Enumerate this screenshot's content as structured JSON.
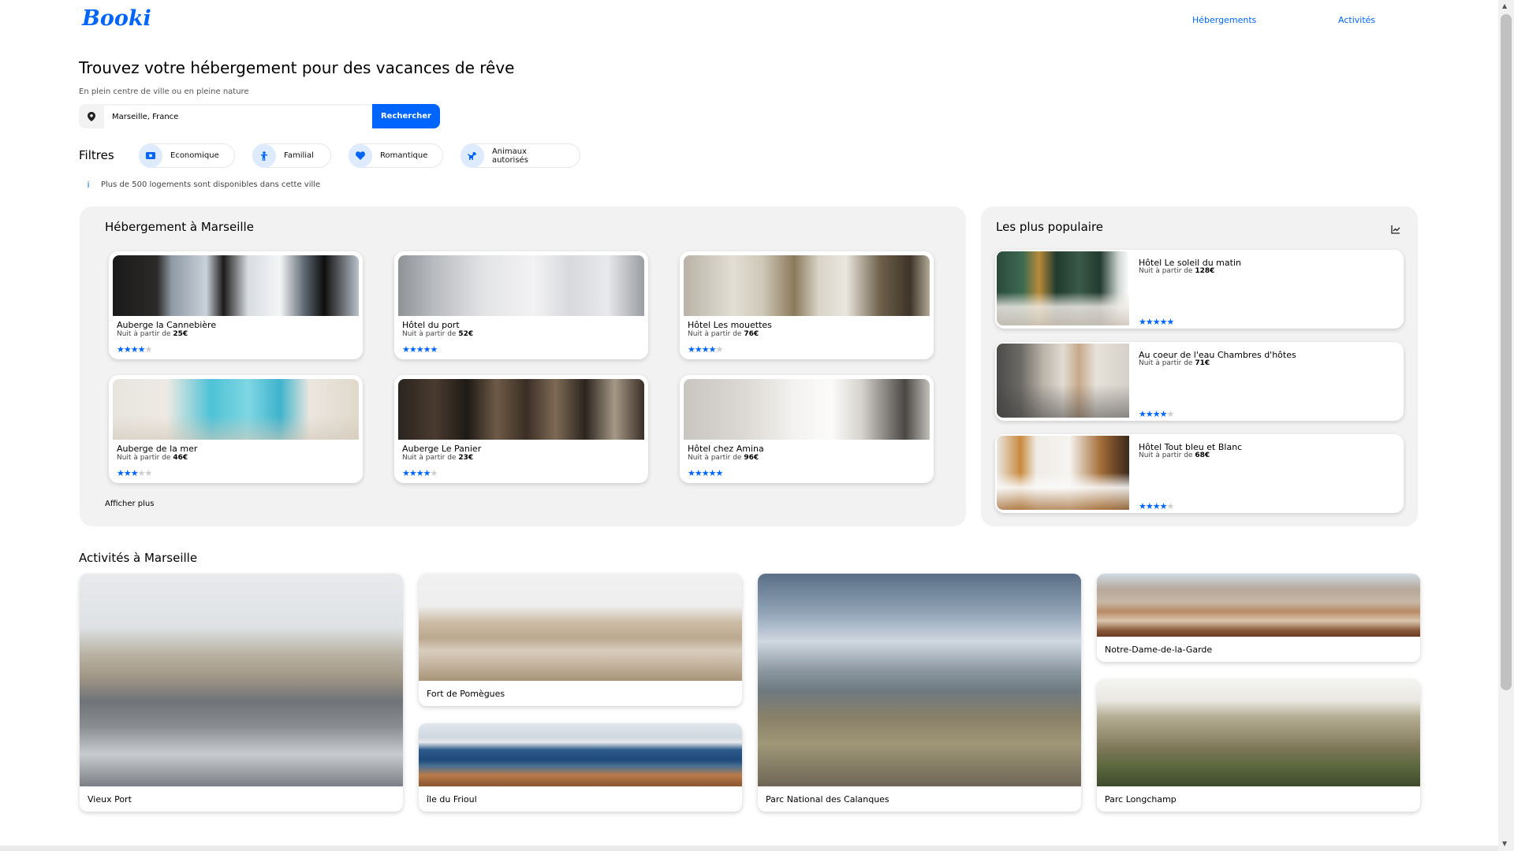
{
  "brand": "Booki",
  "nav": {
    "items": [
      "Hébergements",
      "Activités"
    ]
  },
  "hero": {
    "title": "Trouvez votre hébergement pour des vacances de rêve",
    "subtitle": "En plein centre de ville ou en pleine nature",
    "search_value": "Marseille, France",
    "search_button": "Rechercher"
  },
  "filters": {
    "label": "Filtres",
    "items": [
      {
        "label": "Economique",
        "icon": "money-icon"
      },
      {
        "label": "Familial",
        "icon": "child-icon"
      },
      {
        "label": "Romantique",
        "icon": "heart-icon"
      },
      {
        "label": "Animaux autorisés",
        "icon": "dog-icon"
      }
    ]
  },
  "info": "Plus de 500 logements sont disponibles dans cette ville",
  "accommodations": {
    "title": "Hébergement à Marseille",
    "price_prefix": "Nuit à partir de",
    "show_more": "Afficher plus",
    "items": [
      {
        "name": "Auberge la Cannebière",
        "price": "25€",
        "rating": 4
      },
      {
        "name": "Hôtel du port",
        "price": "52€",
        "rating": 5
      },
      {
        "name": "Hôtel Les mouettes",
        "price": "76€",
        "rating": 4
      },
      {
        "name": "Auberge de la mer",
        "price": "46€",
        "rating": 3
      },
      {
        "name": "Auberge Le Panier",
        "price": "23€",
        "rating": 4
      },
      {
        "name": "Hôtel chez Amina",
        "price": "96€",
        "rating": 5
      }
    ]
  },
  "popular": {
    "title": "Les plus populaire",
    "icon": "chart-line-icon",
    "items": [
      {
        "name": "Hôtel Le soleil du matin",
        "price": "128€",
        "rating": 5
      },
      {
        "name": "Au coeur de l'eau Chambres d'hôtes",
        "price": "71€",
        "rating": 4
      },
      {
        "name": "Hôtel Tout bleu et Blanc",
        "price": "68€",
        "rating": 4
      }
    ]
  },
  "activities": {
    "title": "Activités à Marseille",
    "items": [
      {
        "name": "Vieux Port"
      },
      {
        "name": "Fort de Pomègues"
      },
      {
        "name": "île du Frioul"
      },
      {
        "name": "Parc National des Calanques"
      },
      {
        "name": "Notre-Dame-de-la-Garde"
      },
      {
        "name": "Parc Longchamp"
      }
    ]
  },
  "colors": {
    "primary": "#0065FC",
    "panel": "#F2F2F2",
    "icon_bg": "#DEEBFF"
  }
}
